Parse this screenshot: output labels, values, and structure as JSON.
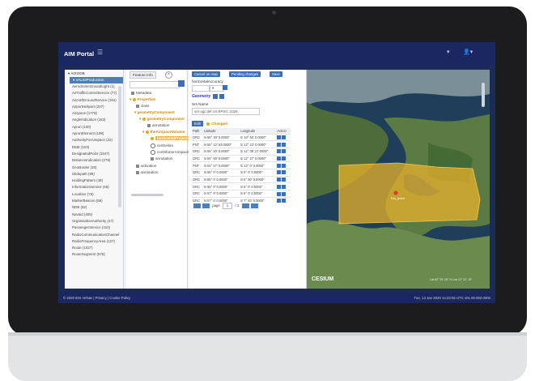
{
  "app": {
    "title": "AIM Portal",
    "menu_icon": "hamburger-icon",
    "header_right_1": "▾",
    "header_right_2": "▾"
  },
  "tree": {
    "root": "AIXODB",
    "selected": "VALIDProduction",
    "items": [
      "AerodromeGroundLight (1)",
      "AirTrafficControlService (77)",
      "AircraftGroundService (164)",
      "AirportHeliport (207)",
      "Airspace (1778)",
      "AngleIndication (153)",
      "Apron (100)",
      "ApronElement (199)",
      "AuthorityForAirspace (22)",
      "DME (103)",
      "DesignatedPoint (1547)",
      "DistanceIndication (279)",
      "GeoBorder (30)",
      "Glidepath (89)",
      "HoldingPattern (48)",
      "InformationService (46)",
      "Localizer (76)",
      "MarkerBeacon (59)",
      "NDB (82)",
      "Navaid (405)",
      "OrganisationAuthority (47)",
      "PassengerService (410)",
      "RadioCommunicationChannel",
      "RadioFrequencyArea (127)",
      "Route (1027)",
      "RouteSegment (675)"
    ]
  },
  "properties": {
    "tab_label": "Feature Info",
    "rows": [
      "Metadata",
      "Properties",
      "class",
      "geometryComponent",
      "geometryComponent",
      "theAirspaceVolume",
      "horizontalProjection",
      "centreline",
      "contributorAirspace",
      "annotation",
      "activation",
      "annotation"
    ],
    "annotation_sub": "annotation"
  },
  "geometry": {
    "buttons": {
      "cancel": "Cancel on map",
      "pending": "Pending changes",
      "save": "Save"
    },
    "field_label": "horizontalAccuracy",
    "title": "Geometry",
    "srs_label": "Srs Name",
    "srs_value": "urn:ogc:def:crs:EPSG::4326",
    "tab_edit": "Edit",
    "tab_changed": "Changed",
    "columns": [
      "Path",
      "Latitude",
      "Longitude",
      "Action"
    ],
    "rows": [
      [
        "GRC",
        "N 58° 30' 0.0000\"",
        "E 10° 50' 0.0000\""
      ],
      [
        "PNT",
        "N 55° 12' 53.0000\"",
        "E 12° 23' 0.0000\""
      ],
      [
        "GRC",
        "N 55° 20' 0.0000\"",
        "E 12° 08' 27.0000\""
      ],
      [
        "GRC",
        "N 54° 50' 0.0000\"",
        "E 12° 27' 0.0000\""
      ],
      [
        "PNT",
        "N 54° 27' 0.0000\"",
        "E 13° 0' 0.0000\""
      ],
      [
        "GRC",
        "N 55° 0' 0.0000\"",
        "E 5° 0' 0.0000\""
      ],
      [
        "GRC",
        "N 55° 0' 0.0000\"",
        "E 5° 30' 0.0000\""
      ],
      [
        "GRC",
        "N 55° 0' 0.0000\"",
        "E 5° 0' 0.0000\""
      ],
      [
        "GRC",
        "N 57° 0' 0.0000\"",
        "E 5° 0' 0.0000\""
      ],
      [
        "GRC",
        "N 57° 0' 0.0000\"",
        "E 7° 40' 0.0000\""
      ]
    ],
    "pager": {
      "page_label": "page",
      "page": "1",
      "of": "/ 3"
    }
  },
  "map": {
    "marker_label": "Est_point",
    "logo": "CESIUM",
    "coords": "Lat 62° 53' 26\" N  Lon 12° 22' 15\"",
    "airspace_color": "#e8b22a"
  },
  "footer": {
    "left": "© 2020 IDS AirNav  |  Privacy  |  Cookie Policy",
    "right": "Tue, 14 Jan 2020 14:23:02 UTC   v01.00.002.0002"
  }
}
